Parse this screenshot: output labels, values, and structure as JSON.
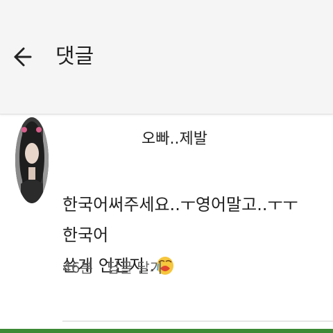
{
  "header": {
    "back_icon": "arrow-left-icon",
    "title": "댓글"
  },
  "comment": {
    "author_suffix": "오빠..제발",
    "text": "한국어써주세요..ㅜ영어말고..ㅜㅜ한국어\n쓴게 언젠지..",
    "emoji_icon": "crying-face-emoji-icon",
    "time": "46분",
    "reply_label": "답글 달기"
  },
  "colors": {
    "app_bar_bg": "#f5f5f5",
    "emoji_yellow": "#f6c63c",
    "bottom_strip": "#3c8a35"
  }
}
